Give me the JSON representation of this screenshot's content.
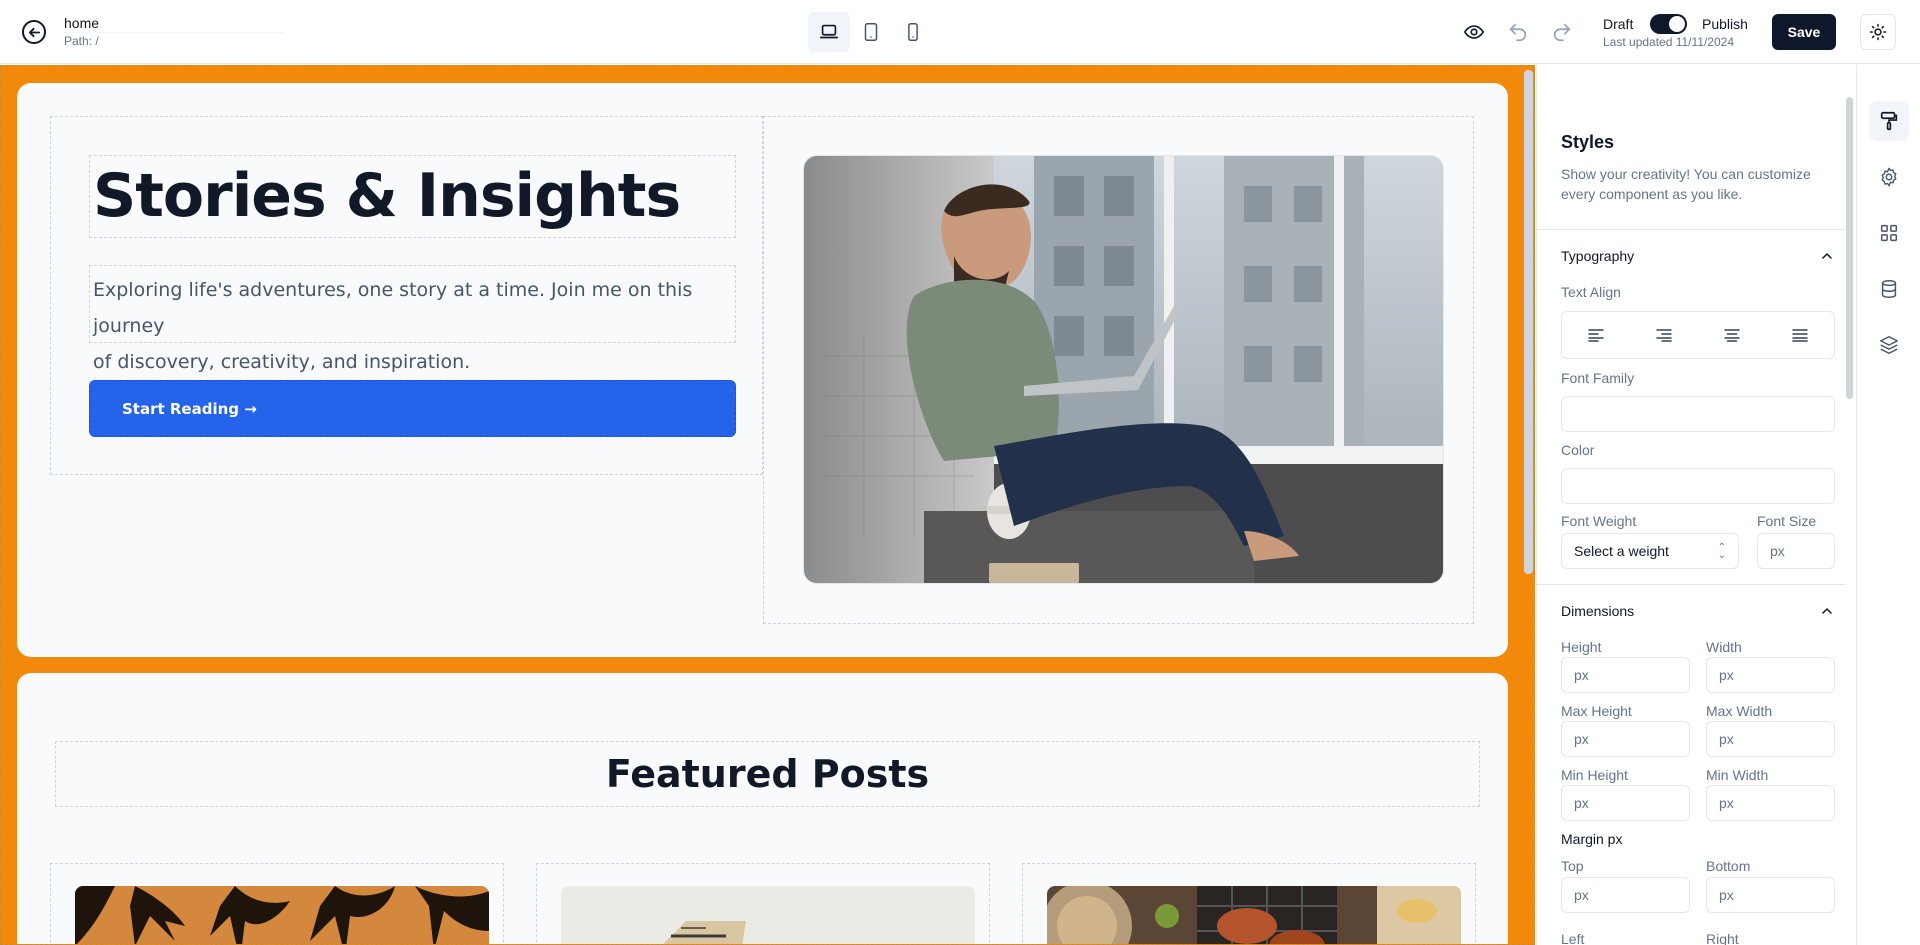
{
  "topbar": {
    "page_name": "home",
    "path": "Path: /",
    "draft_label": "Draft",
    "publish_label": "Publish",
    "last_updated": "Last updated 11/11/2024",
    "save_label": "Save",
    "devices": [
      "laptop-icon",
      "tablet-icon",
      "phone-icon"
    ]
  },
  "hero": {
    "title": "Stories & Insights",
    "subtitle_line1": "Exploring life's adventures, one story at a time. Join me on this journey",
    "subtitle_line2": "of discovery, creativity, and inspiration.",
    "cta_label": "Start Reading →"
  },
  "featured": {
    "title": "Featured Posts"
  },
  "panel": {
    "title": "Styles",
    "description": "Show your creativity! You can customize every component as you like.",
    "typography": {
      "heading": "Typography",
      "text_align_label": "Text Align",
      "font_family_label": "Font Family",
      "font_family_value": "",
      "color_label": "Color",
      "color_value": "",
      "font_weight_label": "Font Weight",
      "font_weight_value": "Select a weight",
      "font_size_label": "Font Size",
      "font_size_placeholder": "px"
    },
    "dimensions": {
      "heading": "Dimensions",
      "height_label": "Height",
      "width_label": "Width",
      "max_height_label": "Max Height",
      "max_width_label": "Max Width",
      "min_height_label": "Min Height",
      "min_width_label": "Min Width",
      "margin_label": "Margin px",
      "top_label": "Top",
      "bottom_label": "Bottom",
      "left_label": "Left",
      "right_label": "Right",
      "placeholder": "px"
    }
  },
  "colors": {
    "canvas_bg": "#f2890a",
    "accent": "#2563eb",
    "save_bg": "#0f172a"
  }
}
